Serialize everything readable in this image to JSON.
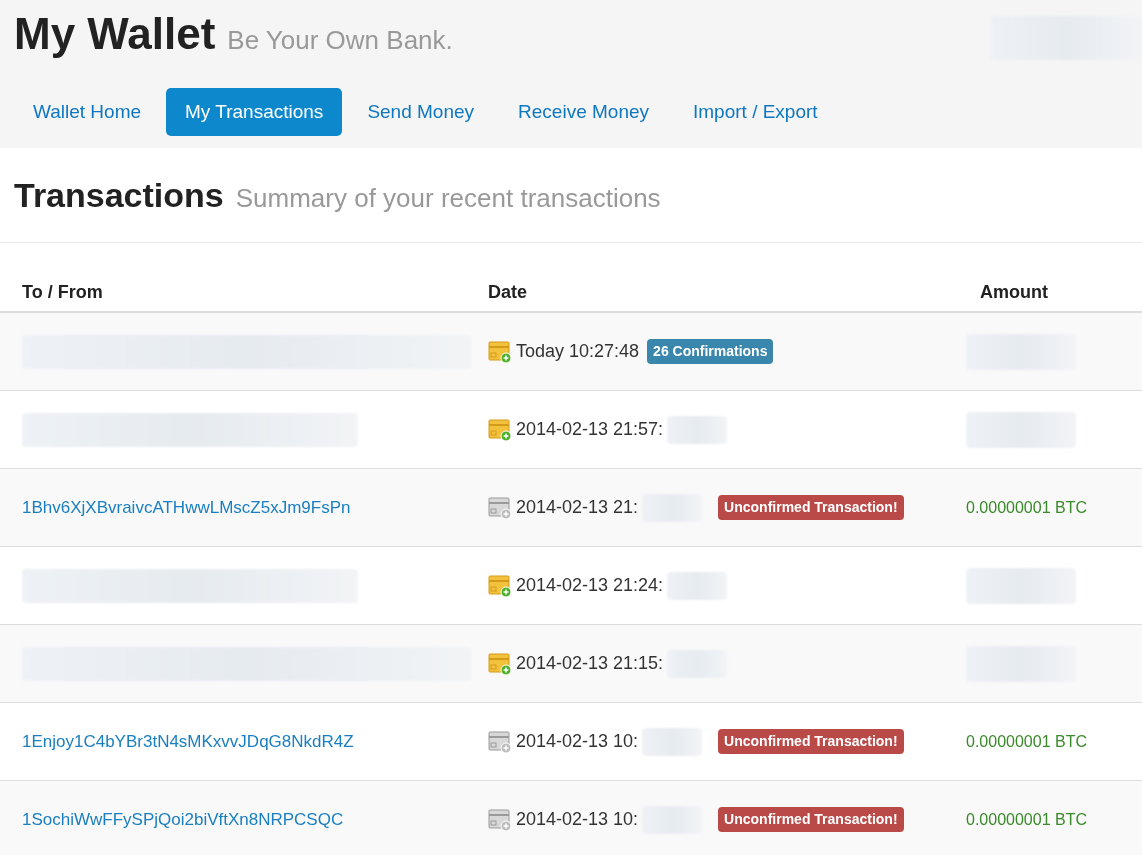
{
  "header": {
    "title": "My Wallet",
    "tagline": "Be Your Own Bank.",
    "account_redacted": true
  },
  "tabs": [
    {
      "label": "Wallet Home",
      "selected": false
    },
    {
      "label": "My Transactions",
      "selected": true
    },
    {
      "label": "Send Money",
      "selected": false
    },
    {
      "label": "Receive Money",
      "selected": false
    },
    {
      "label": "Import / Export",
      "selected": false
    }
  ],
  "section": {
    "title": "Transactions",
    "subtitle": "Summary of your recent transactions"
  },
  "table": {
    "columns": [
      "To / From",
      "Date",
      "Amount"
    ],
    "rows": [
      {
        "address_redacted": true,
        "confirmed": true,
        "date": "Today 10:27:48",
        "badge": {
          "kind": "info",
          "text": "26 Confirmations"
        },
        "amount_redacted": true
      },
      {
        "address_redacted": true,
        "confirmed": true,
        "date": "2014-02-13 21:57:",
        "date_redacted": true,
        "amount_redacted": true
      },
      {
        "address": "1Bhv6XjXBvraivcATHwwLMscZ5xJm9FsPn",
        "confirmed": false,
        "date": "2014-02-13 21:",
        "date_redacted": true,
        "badge": {
          "kind": "danger",
          "text": "Unconfirmed Transaction!"
        },
        "amount": "0.00000001 BTC"
      },
      {
        "address_redacted": true,
        "confirmed": true,
        "date": "2014-02-13 21:24:",
        "date_redacted": true,
        "amount_redacted": true
      },
      {
        "address_redacted": true,
        "confirmed": true,
        "date": "2014-02-13 21:15:",
        "date_redacted": true,
        "amount_redacted": true
      },
      {
        "address": "1Enjoy1C4bYBr3tN4sMKxvvJDqG8NkdR4Z",
        "confirmed": false,
        "date": "2014-02-13 10:",
        "date_redacted": true,
        "badge": {
          "kind": "danger",
          "text": "Unconfirmed Transaction!"
        },
        "amount": "0.00000001 BTC"
      },
      {
        "address": "1SochiWwFFySPjQoi2biVftXn8NRPCSQC",
        "confirmed": false,
        "date": "2014-02-13 10:",
        "date_redacted": true,
        "badge": {
          "kind": "danger",
          "text": "Unconfirmed Transaction!"
        },
        "amount": "0.00000001 BTC"
      }
    ]
  }
}
